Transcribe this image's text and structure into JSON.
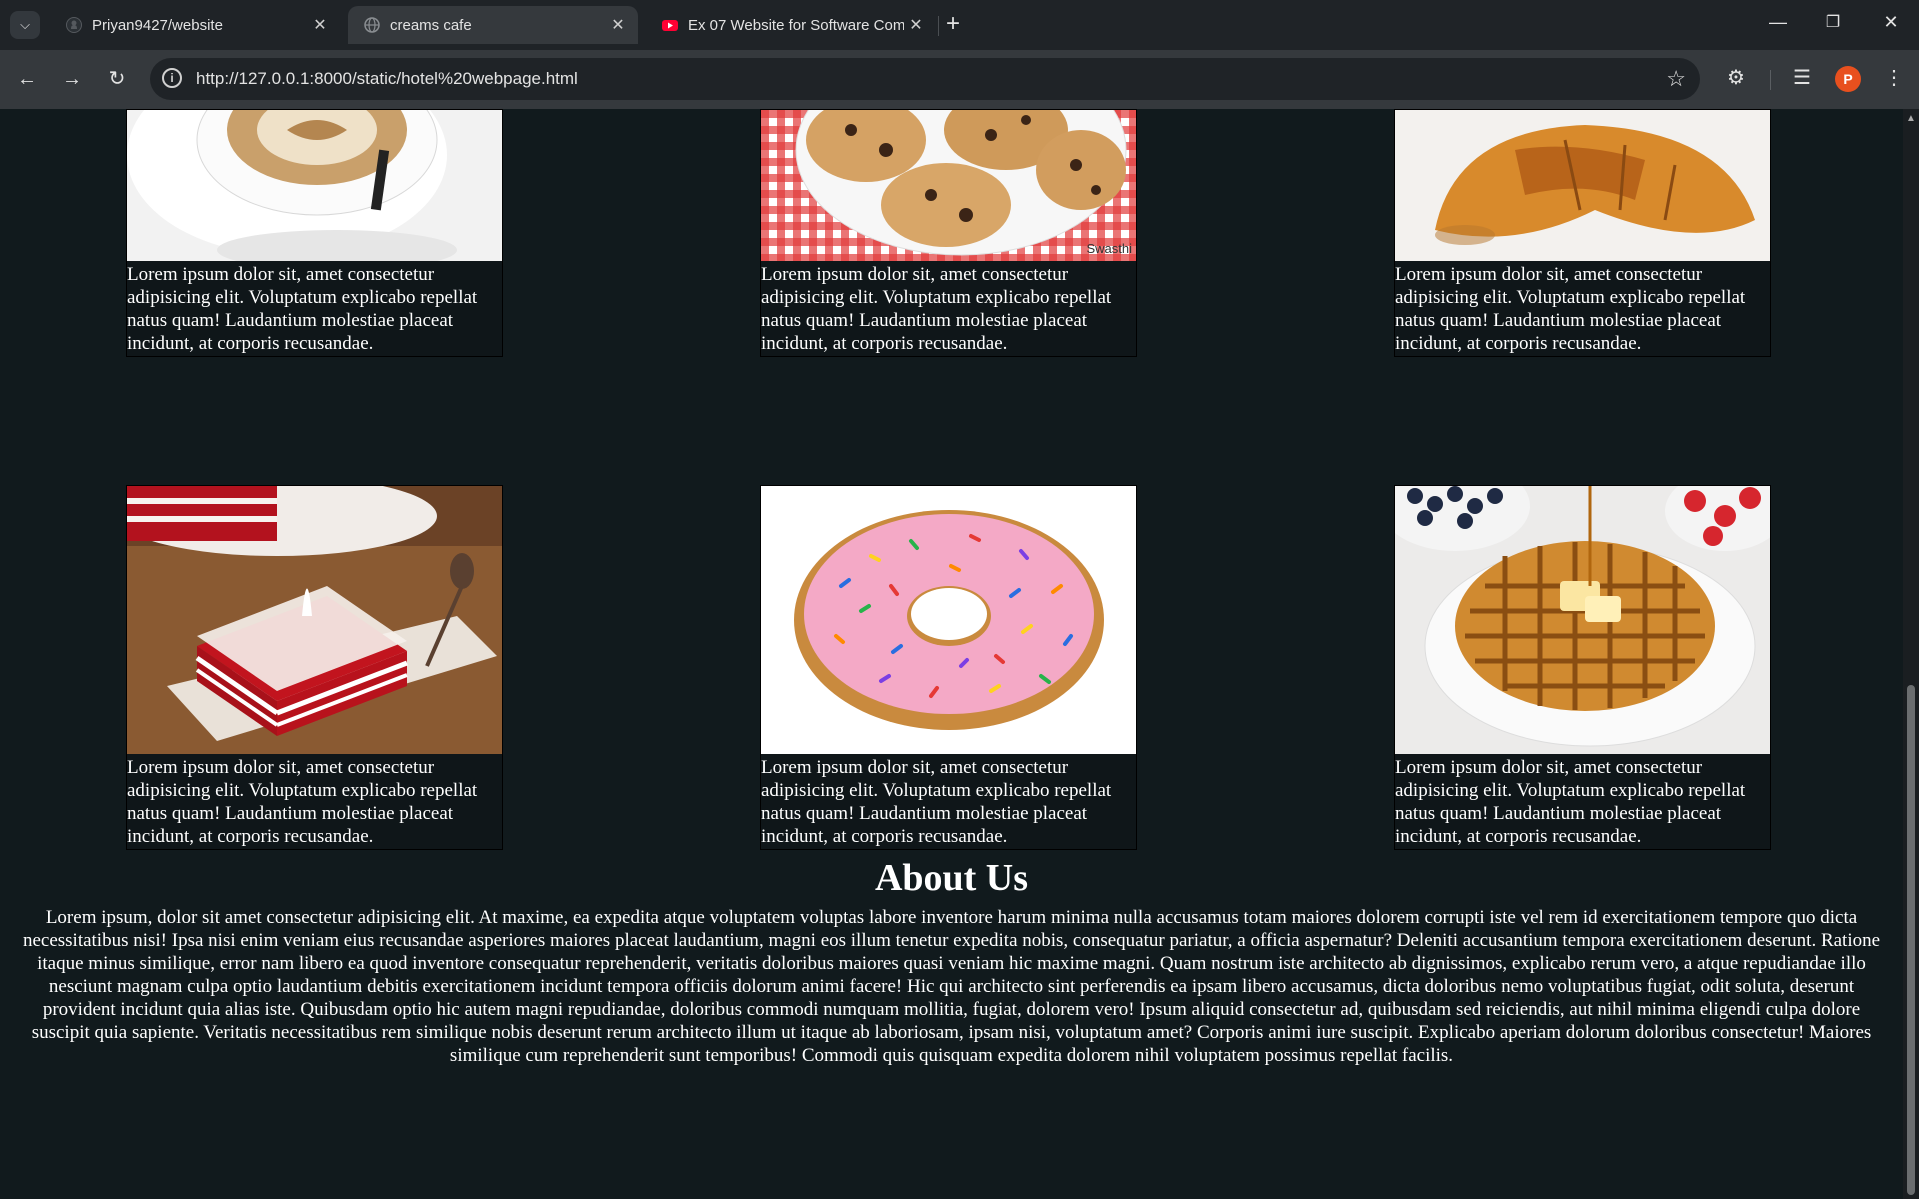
{
  "browser": {
    "tabs": [
      {
        "title": "Priyan9427/website",
        "active": false
      },
      {
        "title": "creams cafe",
        "active": true
      },
      {
        "title": "Ex 07 Website for Software Com",
        "active": false
      }
    ],
    "url": "http://127.0.0.1:8000/static/hotel%20webpage.html",
    "profile_initial": "P",
    "accent": "#e8501e"
  },
  "menu": {
    "items": [
      {
        "name": "coffee",
        "caption": "Lorem ipsum dolor sit, amet consectetur adipisicing elit. Voluptatum explicabo repellat natus quam! Laudantium molestiae placeat incidunt, at corporis recusandae."
      },
      {
        "name": "cookies",
        "watermark": "Swasthi",
        "caption": "Lorem ipsum dolor sit, amet consectetur adipisicing elit. Voluptatum explicabo repellat natus quam! Laudantium molestiae placeat incidunt, at corporis recusandae."
      },
      {
        "name": "croissant",
        "caption": "Lorem ipsum dolor sit, amet consectetur adipisicing elit. Voluptatum explicabo repellat natus quam! Laudantium molestiae placeat incidunt, at corporis recusandae."
      },
      {
        "name": "red velvet cake",
        "caption": "Lorem ipsum dolor sit, amet consectetur adipisicing elit. Voluptatum explicabo repellat natus quam! Laudantium molestiae placeat incidunt, at corporis recusandae."
      },
      {
        "name": "donut",
        "caption": "Lorem ipsum dolor sit, amet consectetur adipisicing elit. Voluptatum explicabo repellat natus quam! Laudantium molestiae placeat incidunt, at corporis recusandae."
      },
      {
        "name": "waffles",
        "caption": "Lorem ipsum dolor sit, amet consectetur adipisicing elit. Voluptatum explicabo repellat natus quam! Laudantium molestiae placeat incidunt, at corporis recusandae."
      }
    ]
  },
  "about": {
    "title": "About Us",
    "text": "Lorem ipsum, dolor sit amet consectetur adipisicing elit. At maxime, ea expedita atque voluptatem voluptas labore inventore harum minima nulla accusamus totam maiores dolorem corrupti iste vel rem id exercitationem tempore quo dicta necessitatibus nisi! Ipsa nisi enim veniam eius recusandae asperiores maiores placeat laudantium, magni eos illum tenetur expedita nobis, consequatur pariatur, a officia aspernatur? Deleniti accusantium tempora exercitationem deserunt. Ratione itaque minus similique, error nam libero ea quod inventore consequatur reprehenderit, veritatis doloribus maiores quasi veniam hic maxime magni. Quam nostrum iste architecto ab dignissimos, explicabo rerum vero, a atque repudiandae illo nesciunt magnam culpa optio laudantium debitis exercitationem incidunt tempora officiis dolorum animi facere! Hic qui architecto sint perferendis ea ipsam libero accusamus, dicta doloribus nemo voluptatibus fugiat, odit soluta, deserunt provident incidunt quia alias iste. Quibusdam optio hic autem magni repudiandae, doloribus commodi numquam mollitia, fugiat, dolorem vero! Ipsum aliquid consectetur ad, quibusdam sed reiciendis, aut nihil minima eligendi culpa dolore suscipit quia sapiente. Veritatis necessitatibus rem similique nobis deserunt rerum architecto illum ut itaque ab laboriosam, ipsam nisi, voluptatum amet? Corporis animi iure suscipit. Explicabo aperiam dolorum doloribus consectetur! Maiores similique cum reprehenderit sunt temporibus! Commodi quis quisquam expedita dolorem nihil voluptatem possimus repellat facilis."
  }
}
